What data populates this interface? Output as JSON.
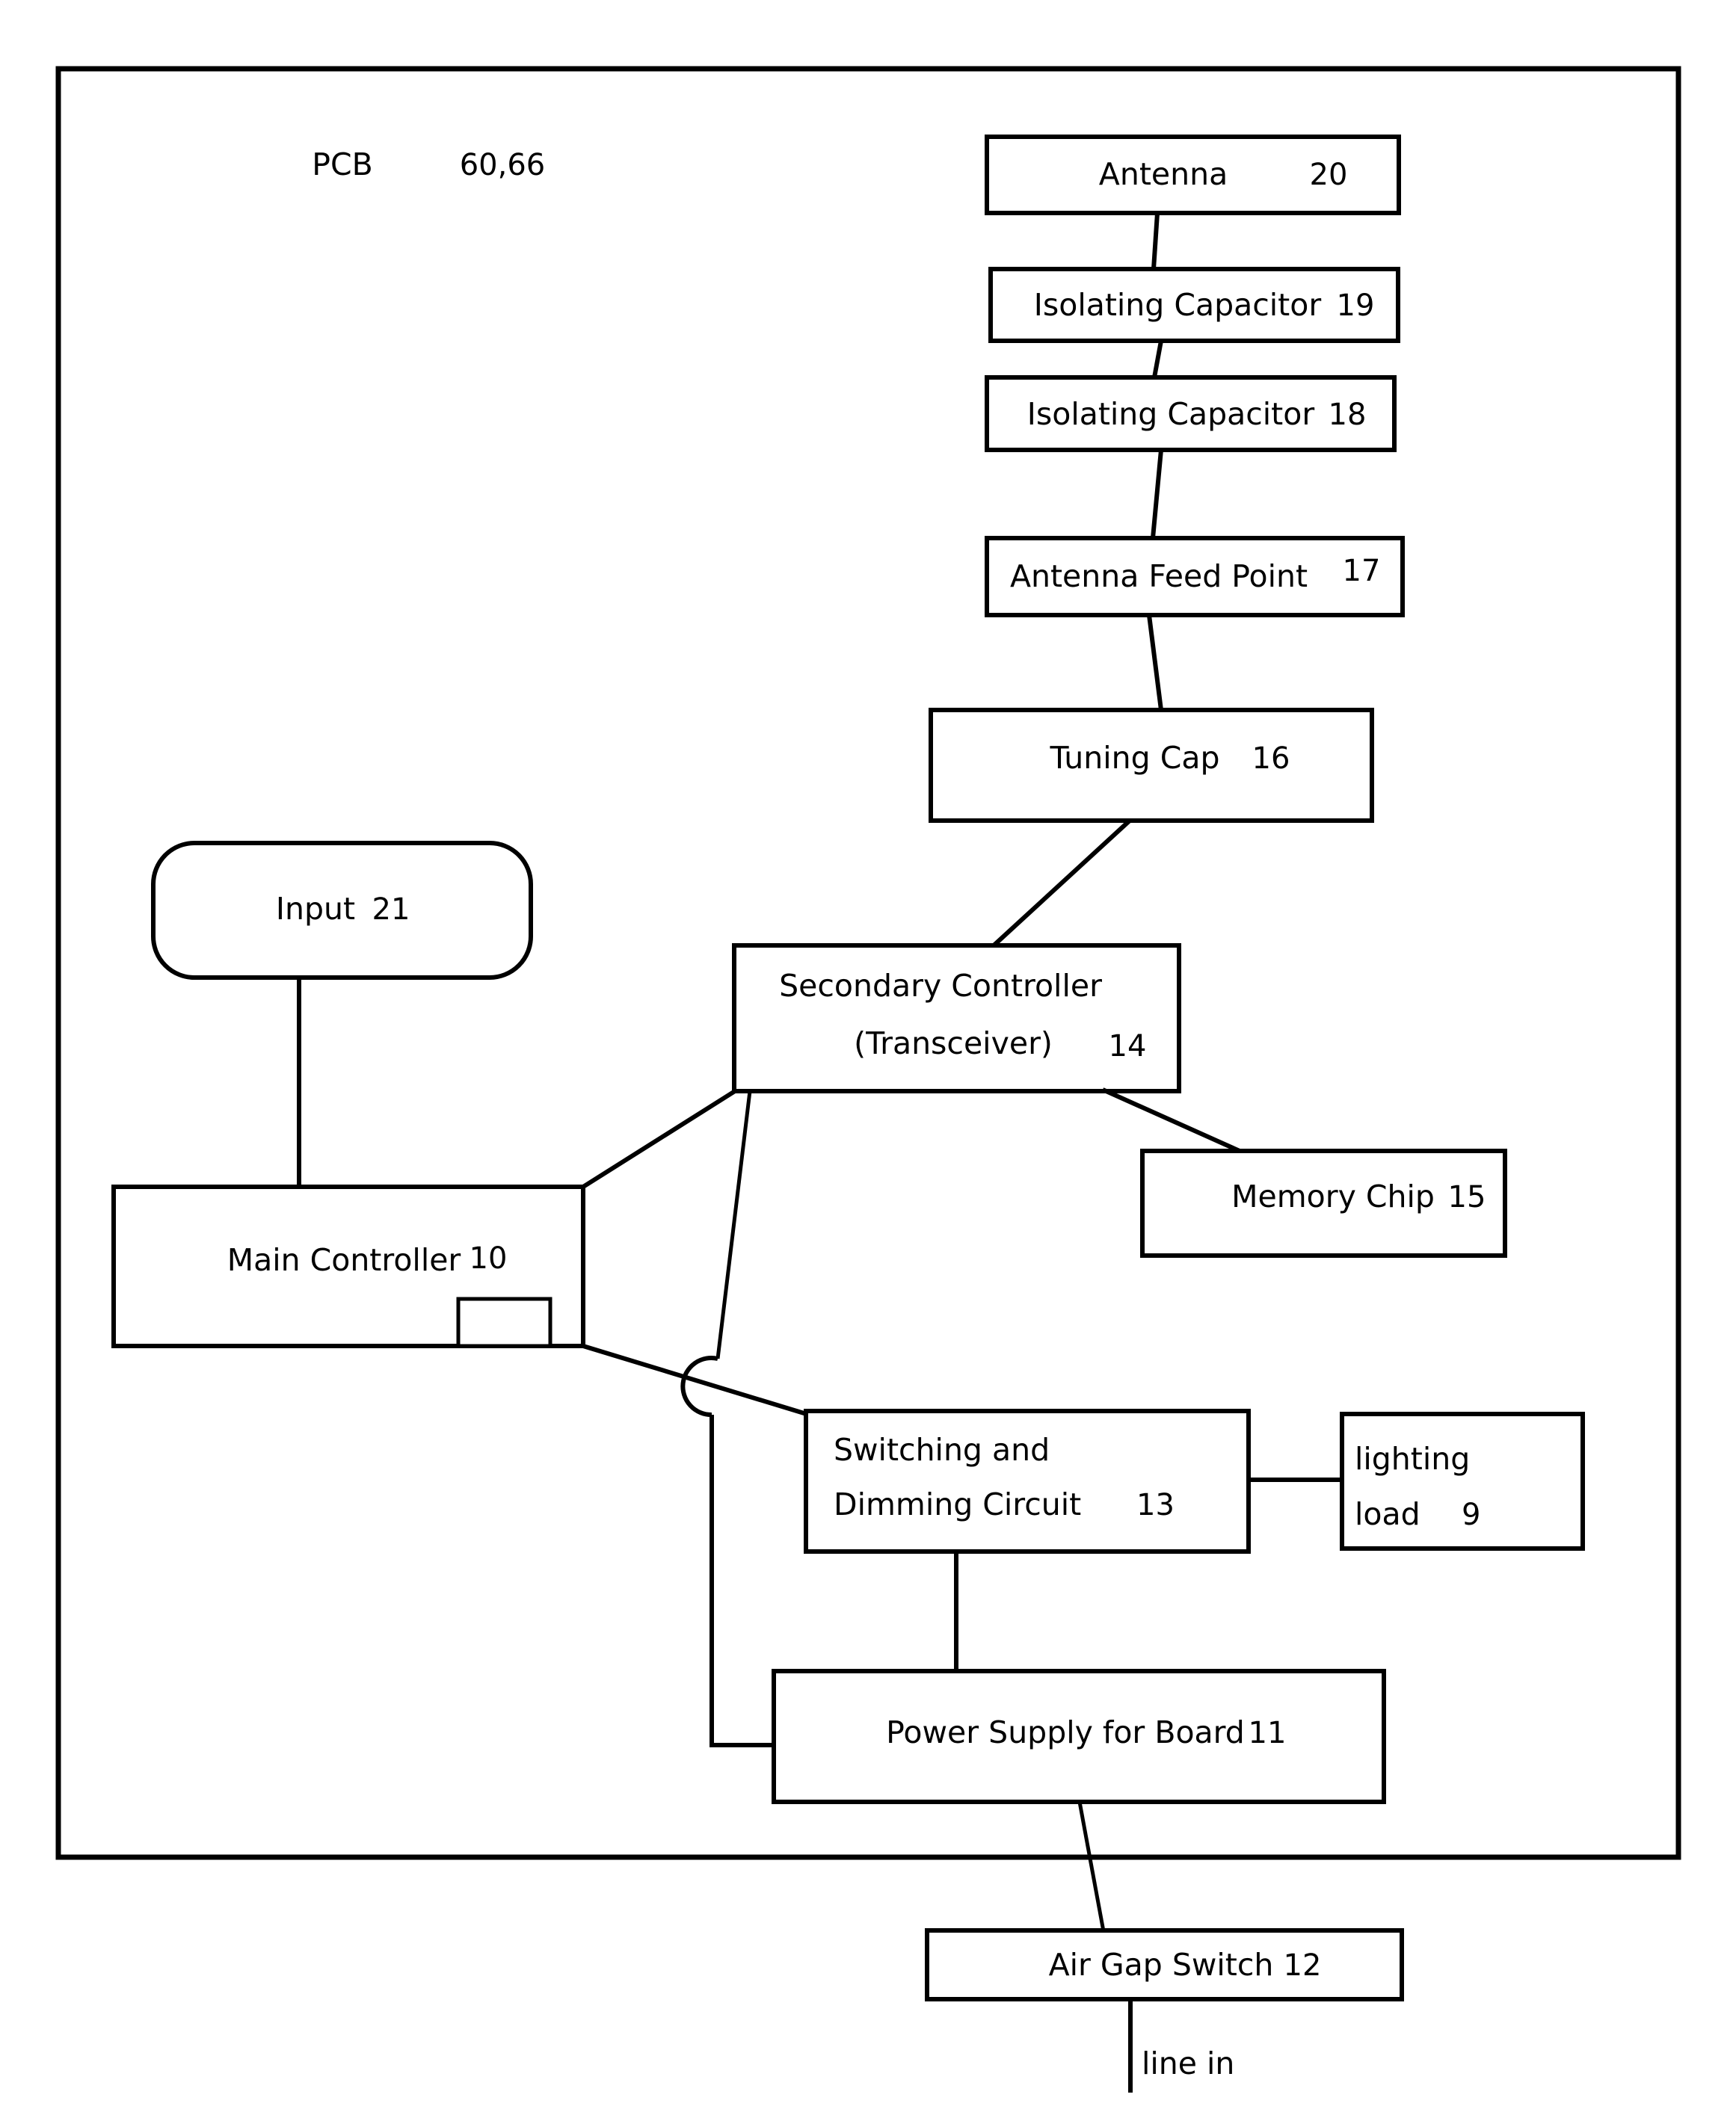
{
  "figure": {
    "type": "patent-block-diagram",
    "enclosure_label": "PCB",
    "enclosure_ref": "60,66"
  },
  "blocks": {
    "antenna": {
      "label": "Antenna",
      "ref": "20"
    },
    "isolating_capacitor_19": {
      "label": "Isolating Capacitor",
      "ref": "19"
    },
    "isolating_capacitor_18": {
      "label": "Isolating Capacitor",
      "ref": "18"
    },
    "antenna_feed_point": {
      "label": "Antenna Feed Point",
      "ref": "17"
    },
    "tuning_cap": {
      "label": "Tuning Cap",
      "ref": "16"
    },
    "secondary_controller": {
      "label_line1": "Secondary Controller",
      "label_line2": "(Transceiver)",
      "ref": "14"
    },
    "memory_chip": {
      "label": "Memory Chip",
      "ref": "15"
    },
    "input": {
      "label": "Input",
      "ref": "21"
    },
    "main_controller": {
      "label": "Main Controller",
      "ref": "10"
    },
    "switching_dimming": {
      "label_line1": "Switching and",
      "label_line2": "Dimming Circuit",
      "ref": "13"
    },
    "lighting_load": {
      "label_line1": "lighting",
      "label_line2": "load",
      "ref": "9"
    },
    "power_supply": {
      "label": "Power Supply for Board",
      "ref": "11"
    },
    "air_gap_switch": {
      "label": "Air Gap Switch",
      "ref": "12"
    },
    "line_in": {
      "label": "line in"
    }
  },
  "colors": {
    "stroke": "#000000",
    "fill": "#ffffff"
  }
}
